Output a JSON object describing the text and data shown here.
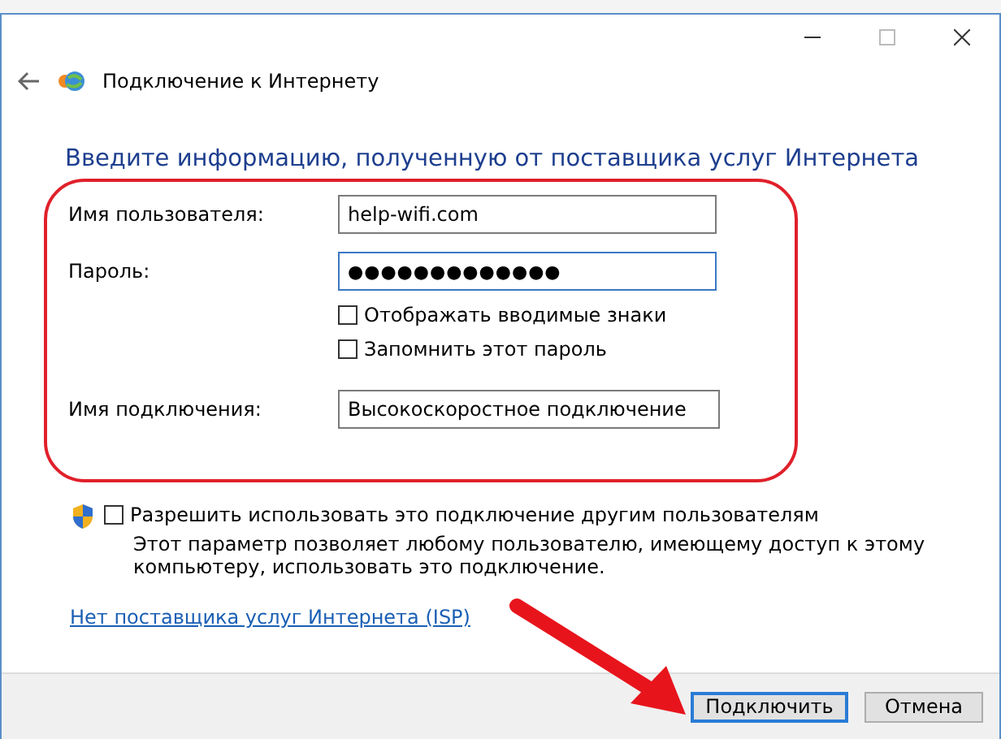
{
  "nav": {
    "title": "Подключение к Интернету"
  },
  "heading": "Введите информацию, полученную от поставщика услуг Интернета",
  "fields": [
    {
      "label": "Имя пользователя:",
      "kind": "text",
      "value": "help-wifi.com",
      "focused": false
    },
    {
      "label": "Пароль:",
      "kind": "password",
      "value": "●●●●●●●●●●●●●",
      "focused": true
    },
    {
      "label": "Имя подключения:",
      "kind": "text",
      "value": "Высокоскоростное подключение",
      "focused": false
    }
  ],
  "password_options": [
    {
      "label": "Отображать вводимые знаки",
      "checked": false
    },
    {
      "label": "Запомнить этот пароль",
      "checked": false
    }
  ],
  "share": {
    "label": "Разрешить использовать это подключение другим пользователям",
    "checked": false,
    "description": "Этот параметр позволяет любому пользователю, имеющему доступ к этому компьютеру, использовать это подключение."
  },
  "link": "Нет поставщика услуг Интернета (ISP)",
  "buttons": [
    {
      "label": "Подключить",
      "default": true
    },
    {
      "label": "Отмена",
      "default": false
    }
  ]
}
